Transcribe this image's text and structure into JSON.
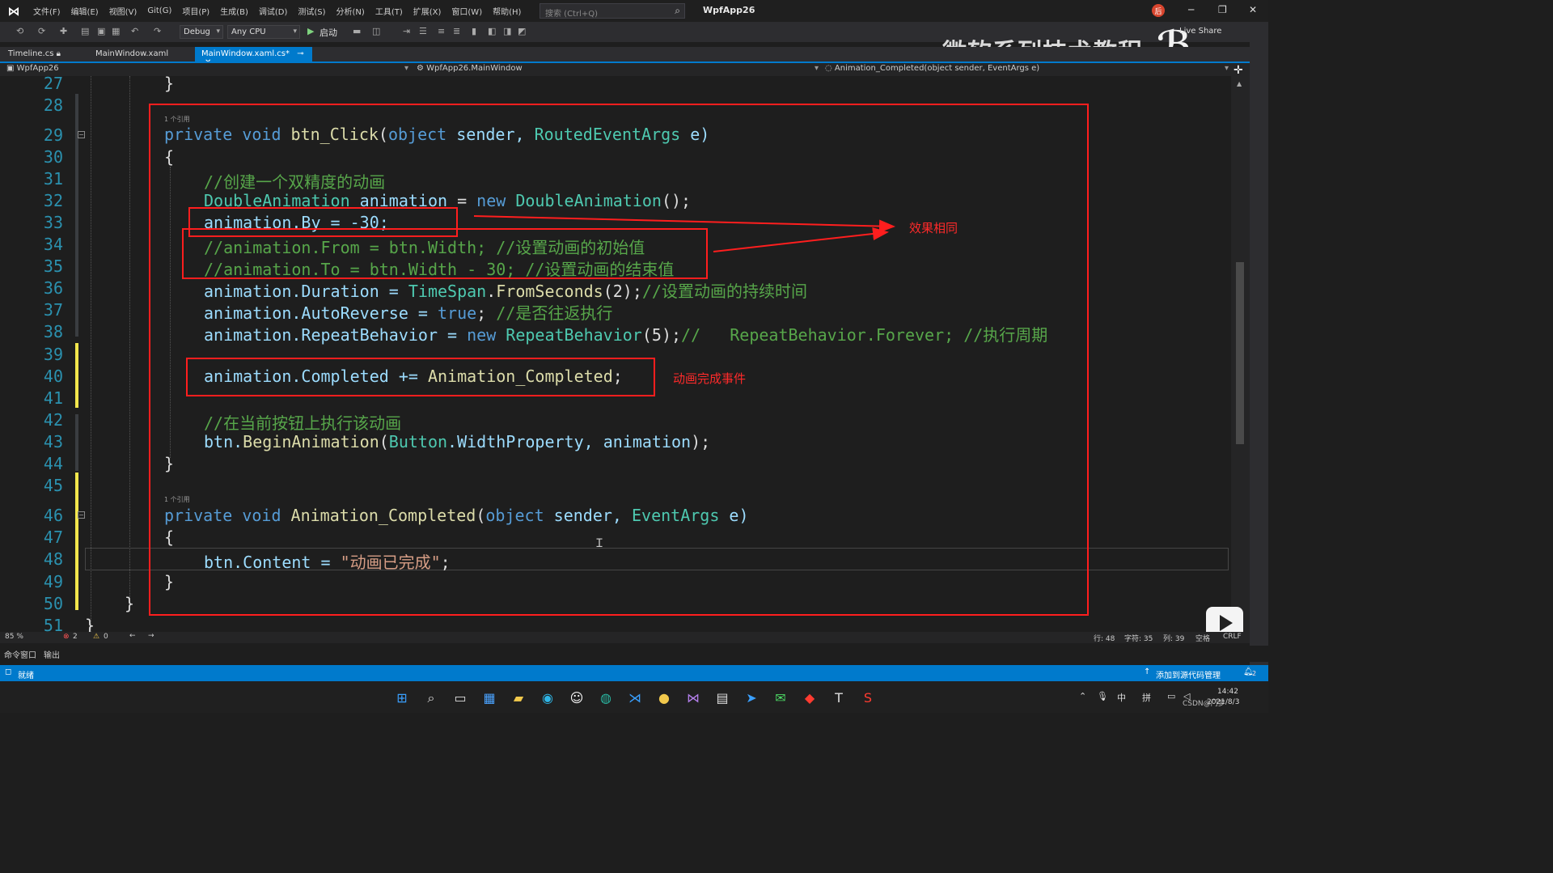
{
  "menu": {
    "items": [
      "文件(F)",
      "编辑(E)",
      "视图(V)",
      "Git(G)",
      "项目(P)",
      "生成(B)",
      "调试(D)",
      "测试(S)",
      "分析(N)",
      "工具(T)",
      "扩展(X)",
      "窗口(W)",
      "帮助(H)"
    ],
    "search_placeholder": "搜索 (Ctrl+Q)",
    "app_title": "WpfApp26",
    "user_initial": "后"
  },
  "toolbar": {
    "config": "Debug",
    "platform": "Any CPU",
    "start_label": "启动",
    "live_share": "Live Share"
  },
  "watermark": {
    "text": "微软系列技术教程",
    "logo": "bilibili"
  },
  "tabs": [
    {
      "label": "Timeline.cs"
    },
    {
      "label": "MainWindow.xaml"
    },
    {
      "label": "MainWindow.xaml.cs*"
    }
  ],
  "nav": {
    "project": "WpfApp26",
    "class": "WpfApp26.MainWindow",
    "member": "Animation_Completed(object sender, EventArgs e)"
  },
  "editor": {
    "line_numbers": [
      "27",
      "28",
      "29",
      "30",
      "31",
      "32",
      "33",
      "34",
      "35",
      "36",
      "37",
      "38",
      "39",
      "40",
      "41",
      "42",
      "43",
      "44",
      "45",
      "46",
      "47",
      "48",
      "49",
      "50",
      "51"
    ],
    "codelens_1": "1 个引用",
    "codelens_2": "1 个引用",
    "lines": {
      "l27": "}",
      "l29_kw": "private void ",
      "l29_fn": "btn_Click",
      "l29_p1": "(",
      "l29_t1": "object",
      "l29_v1": " sender, ",
      "l29_t2": "RoutedEventArgs",
      "l29_v2": " e)",
      "l30": "{",
      "l31": "//创建一个双精度的动画",
      "l32_t": "DoubleAnimation",
      "l32_v": " animation",
      "l32_eq": " = ",
      "l32_kw": "new",
      "l32_t2": " DoubleAnimation",
      "l32_end": "();",
      "l33": "animation.By = -30;",
      "l34": "//animation.From = btn.Width; //设置动画的初始值",
      "l35": "//animation.To = btn.Width - 30; //设置动画的结束值",
      "l36_a": "animation.Duration = ",
      "l36_t": "TimeSpan",
      "l36_b": ".",
      "l36_f": "FromSeconds",
      "l36_c": "(2);",
      "l36_cm": "//设置动画的持续时间",
      "l37_a": "animation.AutoReverse = ",
      "l37_kw": "true",
      "l37_b": "; ",
      "l37_cm": "//是否往返执行",
      "l38_a": "animation.RepeatBehavior = ",
      "l38_kw": "new",
      "l38_t": " RepeatBehavior",
      "l38_b": "(5);",
      "l38_cm": "//   RepeatBehavior.Forever; //执行周期",
      "l40_a": "animation.Completed += ",
      "l40_f": "Animation_Completed",
      "l40_b": ";",
      "l42": "//在当前按钮上执行该动画",
      "l43_a": "btn.",
      "l43_f": "BeginAnimation",
      "l43_b": "(",
      "l43_t": "Button",
      "l43_c": ".WidthProperty, ",
      "l43_v": "animation",
      "l43_d": ");",
      "l44": "}",
      "l46_kw": "private void ",
      "l46_fn": "Animation_Completed",
      "l46_p1": "(",
      "l46_t1": "object",
      "l46_v1": " sender, ",
      "l46_t2": "EventArgs",
      "l46_v2": " e)",
      "l47": "{",
      "l48_a": "btn.Content = ",
      "l48_s": "\"动画已完成\"",
      "l48_b": ";",
      "l49": "}",
      "l50": "}",
      "l51": "}"
    }
  },
  "annotations": {
    "same_effect": "效果相同",
    "completed_event": "动画完成事件"
  },
  "editor_status": {
    "zoom": "85 %",
    "errors": "2",
    "warnings": "0",
    "row": "行: 48",
    "char": "字符: 35",
    "col": "列: 39",
    "mode": "空格",
    "eol": "CRLF"
  },
  "panel_tabs": [
    "命令窗口",
    "输出"
  ],
  "statusbar": {
    "left": "就绪",
    "right": "添加到源代码管理",
    "notif": "2"
  },
  "taskbar": {
    "time": "14:42",
    "date": "2021/8/3",
    "ime1": "中",
    "ime2": "拼",
    "csdn": "CSDN@门梦"
  },
  "colors": {
    "accent": "#007acc",
    "annotation": "#ff1e1e",
    "keyword": "#569cd6",
    "type": "#4ec9b0",
    "comment": "#57a64a",
    "string": "#d69d85",
    "linenumber": "#2b91af"
  }
}
